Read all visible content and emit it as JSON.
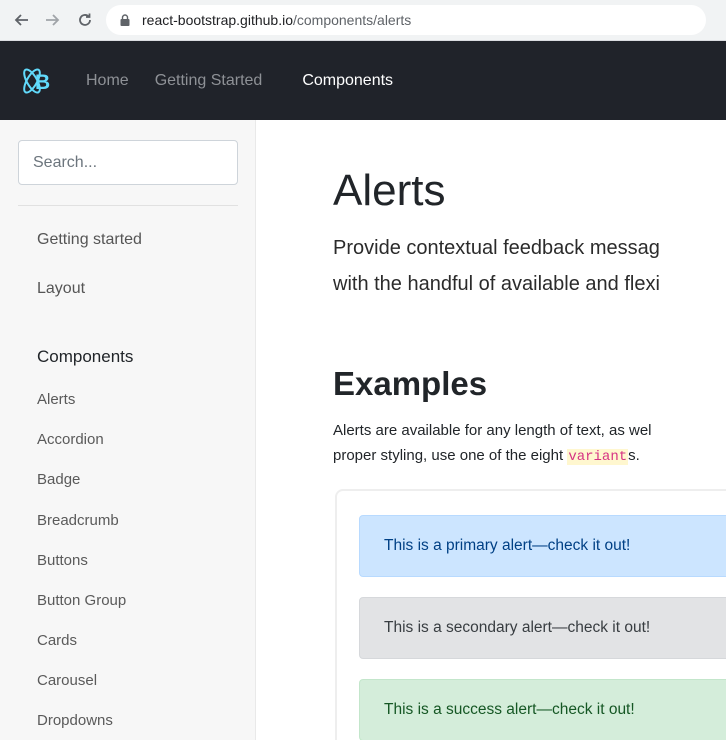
{
  "browser": {
    "url_host": "react-bootstrap.github.io",
    "url_path": "/components/alerts",
    "icons": [
      "back-arrow-icon",
      "forward-arrow-icon",
      "reload-icon",
      "lock-icon"
    ]
  },
  "navbar": {
    "background": "#20232a",
    "accent": "#61dafb",
    "links": [
      {
        "label": "Home"
      },
      {
        "label": "Getting Started"
      },
      {
        "label": "Components",
        "active": true
      }
    ]
  },
  "sidebar": {
    "search_placeholder": "Search...",
    "top_links": [
      {
        "label": "Getting started"
      },
      {
        "label": "Layout"
      }
    ],
    "section_heading": "Components",
    "items": [
      {
        "label": "Alerts"
      },
      {
        "label": "Accordion"
      },
      {
        "label": "Badge"
      },
      {
        "label": "Breadcrumb"
      },
      {
        "label": "Buttons"
      },
      {
        "label": "Button Group"
      },
      {
        "label": "Cards"
      },
      {
        "label": "Carousel"
      },
      {
        "label": "Dropdowns"
      }
    ]
  },
  "main": {
    "title": "Alerts",
    "lead_line1": "Provide contextual feedback messag",
    "lead_line2": "with the handful of available and flexi",
    "examples_heading": "Examples",
    "para_line1": "Alerts are available for any length of text, as wel",
    "para_line2_pre": "proper styling, use one of the eight ",
    "para_code": "variant",
    "para_line2_post": "s.",
    "alerts": [
      {
        "label": "This is a primary alert—check it out!",
        "variant": "primary",
        "color": "#cce5ff"
      },
      {
        "label": "This is a secondary alert—check it out!",
        "variant": "secondary",
        "color": "#e2e3e5"
      },
      {
        "label": "This is a success alert—check it out!",
        "variant": "success",
        "color": "#d4edda"
      }
    ]
  }
}
